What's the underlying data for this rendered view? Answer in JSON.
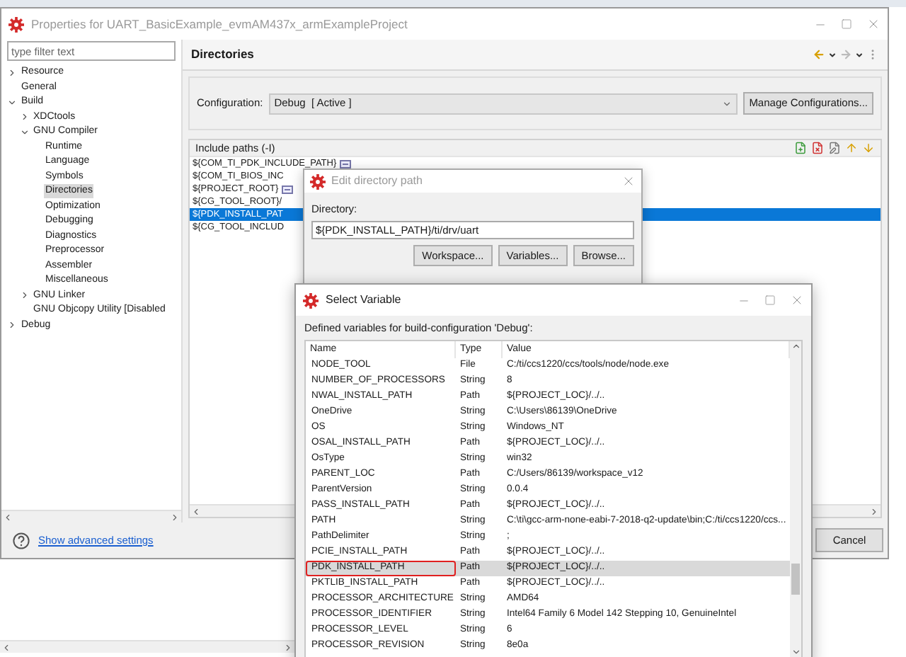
{
  "main_window": {
    "title": "Properties for UART_BasicExample_evmAM437x_armExampleProject",
    "filter": {
      "placeholder": "type filter text"
    },
    "tree": [
      {
        "label": "Resource",
        "expanded": false,
        "selected": false
      },
      {
        "label": "General",
        "selected": false
      },
      {
        "label": "Build",
        "expanded": true,
        "selected": false,
        "children": [
          {
            "label": "XDCtools",
            "expanded": false,
            "selected": false
          },
          {
            "label": "GNU Compiler",
            "expanded": true,
            "selected": false,
            "children": [
              {
                "label": "Runtime",
                "selected": false
              },
              {
                "label": "Language",
                "selected": false
              },
              {
                "label": "Symbols",
                "selected": false
              },
              {
                "label": "Directories",
                "selected": true
              },
              {
                "label": "Optimization",
                "selected": false
              },
              {
                "label": "Debugging",
                "selected": false
              },
              {
                "label": "Diagnostics",
                "selected": false
              },
              {
                "label": "Preprocessor",
                "selected": false
              },
              {
                "label": "Assembler",
                "selected": false
              },
              {
                "label": "Miscellaneous",
                "selected": false
              }
            ]
          },
          {
            "label": "GNU Linker",
            "expanded": false,
            "selected": false
          },
          {
            "label": "GNU Objcopy Utility [Disabled",
            "selected": false
          }
        ]
      },
      {
        "label": "Debug",
        "expanded": false,
        "selected": false
      }
    ],
    "page_title": "Directories",
    "configuration": {
      "label": "Configuration:",
      "value": "Debug  [ Active ]"
    },
    "manage_button": "Manage Configurations...",
    "include_paths": {
      "header": "Include paths (-I)",
      "rows": [
        {
          "text": "${COM_TI_PDK_INCLUDE_PATH}",
          "kind": "noted",
          "selected": false
        },
        {
          "text": "${COM_TI_BIOS_INC",
          "kind": "plain",
          "selected": false
        },
        {
          "text": "${PROJECT_ROOT}",
          "kind": "noted",
          "selected": false
        },
        {
          "text": "${CG_TOOL_ROOT}/",
          "kind": "plain",
          "selected": false
        },
        {
          "text": "${PDK_INSTALL_PAT",
          "kind": "plain",
          "selected": true
        },
        {
          "text": "${CG_TOOL_INCLUD",
          "kind": "plain",
          "selected": false
        }
      ]
    },
    "advanced_link": "Show advanced settings",
    "cancel_button": "Cancel"
  },
  "edit_dialog": {
    "title": "Edit directory path",
    "label": "Directory:",
    "value": "${PDK_INSTALL_PATH}/ti/drv/uart",
    "buttons": [
      "Workspace...",
      "Variables...",
      "Browse..."
    ]
  },
  "select_variable": {
    "title": "Select Variable",
    "caption": "Defined variables for build-configuration 'Debug':",
    "columns": [
      "Name",
      "Type",
      "Value"
    ],
    "rows": [
      {
        "name": "NODE_TOOL",
        "type": "File",
        "value": "C:/ti/ccs1220/ccs/tools/node/node.exe",
        "selected": false,
        "outlined": false
      },
      {
        "name": "NUMBER_OF_PROCESSORS",
        "type": "String",
        "value": "8",
        "selected": false,
        "outlined": false
      },
      {
        "name": "NWAL_INSTALL_PATH",
        "type": "Path",
        "value": "${PROJECT_LOC}/../..",
        "selected": false,
        "outlined": false
      },
      {
        "name": "OneDrive",
        "type": "String",
        "value": "C:\\Users\\86139\\OneDrive",
        "selected": false,
        "outlined": false
      },
      {
        "name": "OS",
        "type": "String",
        "value": "Windows_NT",
        "selected": false,
        "outlined": false
      },
      {
        "name": "OSAL_INSTALL_PATH",
        "type": "Path",
        "value": "${PROJECT_LOC}/../..",
        "selected": false,
        "outlined": false
      },
      {
        "name": "OsType",
        "type": "String",
        "value": "win32",
        "selected": false,
        "outlined": false
      },
      {
        "name": "PARENT_LOC",
        "type": "Path",
        "value": "C:/Users/86139/workspace_v12",
        "selected": false,
        "outlined": false
      },
      {
        "name": "ParentVersion",
        "type": "String",
        "value": "0.0.4",
        "selected": false,
        "outlined": false
      },
      {
        "name": "PASS_INSTALL_PATH",
        "type": "Path",
        "value": "${PROJECT_LOC}/../..",
        "selected": false,
        "outlined": false
      },
      {
        "name": "PATH",
        "type": "String",
        "value": "C:\\ti\\gcc-arm-none-eabi-7-2018-q2-update\\bin;C:/ti/ccs1220/ccs...",
        "selected": false,
        "outlined": false
      },
      {
        "name": "PathDelimiter",
        "type": "String",
        "value": ";",
        "selected": false,
        "outlined": false
      },
      {
        "name": "PCIE_INSTALL_PATH",
        "type": "Path",
        "value": "${PROJECT_LOC}/../..",
        "selected": false,
        "outlined": false
      },
      {
        "name": "PDK_INSTALL_PATH",
        "type": "Path",
        "value": "${PROJECT_LOC}/../..",
        "selected": true,
        "outlined": true
      },
      {
        "name": "PKTLIB_INSTALL_PATH",
        "type": "Path",
        "value": "${PROJECT_LOC}/../..",
        "selected": false,
        "outlined": false
      },
      {
        "name": "PROCESSOR_ARCHITECTURE",
        "type": "String",
        "value": "AMD64",
        "selected": false,
        "outlined": false
      },
      {
        "name": "PROCESSOR_IDENTIFIER",
        "type": "String",
        "value": "Intel64 Family 6 Model 142 Stepping 10, GenuineIntel",
        "selected": false,
        "outlined": false
      },
      {
        "name": "PROCESSOR_LEVEL",
        "type": "String",
        "value": "6",
        "selected": false,
        "outlined": false
      },
      {
        "name": "PROCESSOR_REVISION",
        "type": "String",
        "value": "8e0a",
        "selected": false,
        "outlined": false
      }
    ]
  }
}
